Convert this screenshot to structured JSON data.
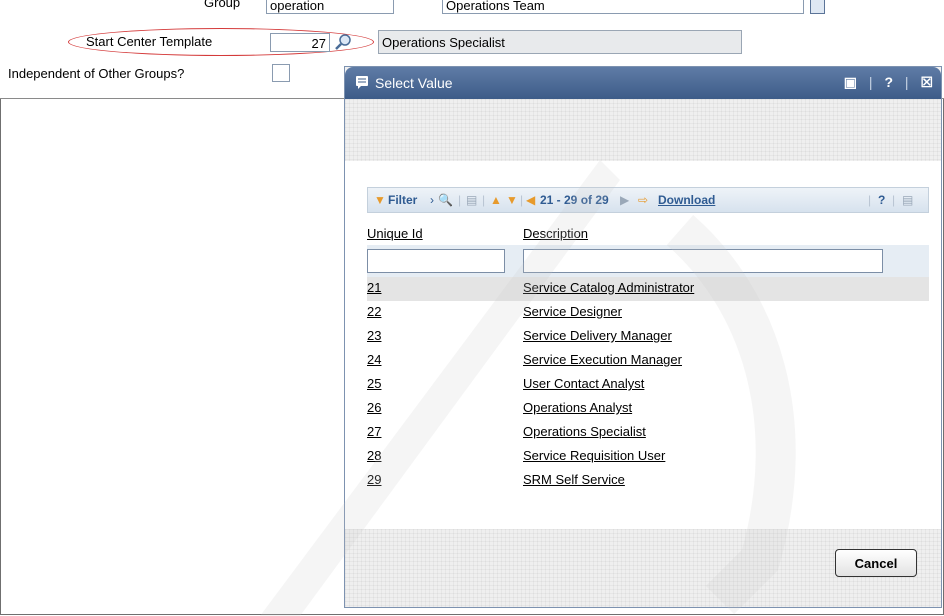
{
  "form": {
    "group_label": "Group",
    "group_value": "operation",
    "group_desc": "Operations Team",
    "sct_label": "Start Center Template",
    "sct_value": "27",
    "sct_desc": "Operations Specialist",
    "independent_label": "Independent of Other Groups?"
  },
  "dialog": {
    "title": "Select Value",
    "toolbar": {
      "filter_label": "Filter",
      "range_label": "21 - 29 of 29",
      "download_label": "Download"
    },
    "columns": {
      "id": "Unique Id",
      "desc": "Description"
    },
    "rows": [
      {
        "id": "21",
        "desc": "Service Catalog Administrator"
      },
      {
        "id": "22",
        "desc": "Service Designer"
      },
      {
        "id": "23",
        "desc": "Service Delivery Manager"
      },
      {
        "id": "24",
        "desc": "Service Execution Manager"
      },
      {
        "id": "25",
        "desc": "User Contact Analyst"
      },
      {
        "id": "26",
        "desc": "Operations Analyst"
      },
      {
        "id": "27",
        "desc": "Operations Specialist"
      },
      {
        "id": "28",
        "desc": "Service Requisition User"
      },
      {
        "id": "29",
        "desc": "SRM Self Service"
      }
    ],
    "cancel_label": "Cancel"
  }
}
